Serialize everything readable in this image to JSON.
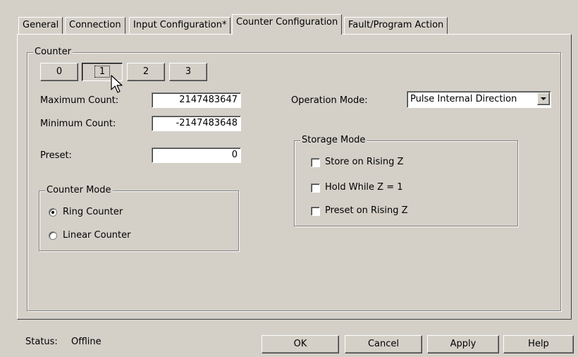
{
  "tabs": [
    {
      "label": "General",
      "active": false
    },
    {
      "label": "Connection",
      "active": false
    },
    {
      "label": "Input Configuration*",
      "active": false
    },
    {
      "label": "Counter Configuration",
      "active": true
    },
    {
      "label": "Fault/Program Action",
      "active": false
    }
  ],
  "counter": {
    "group_label": "Counter",
    "buttons": [
      "0",
      "1",
      "2",
      "3"
    ],
    "selected": "1",
    "max_count_label": "Maximum Count:",
    "max_count_value": "2147483647",
    "min_count_label": "Minimum Count:",
    "min_count_value": "-2147483648",
    "preset_label": "Preset:",
    "preset_value": "0"
  },
  "counter_mode": {
    "group_label": "Counter Mode",
    "options": [
      "Ring Counter",
      "Linear Counter"
    ],
    "selected": "Ring Counter"
  },
  "operation_mode": {
    "label": "Operation Mode:",
    "value": "Pulse Internal Direction"
  },
  "storage_mode": {
    "group_label": "Storage Mode",
    "options": [
      {
        "label": "Store on Rising Z",
        "checked": false
      },
      {
        "label": "Hold While Z = 1",
        "checked": false
      },
      {
        "label": "Preset on Rising Z",
        "checked": false
      }
    ]
  },
  "status": {
    "label": "Status:",
    "value": "Offline"
  },
  "footer_buttons": {
    "ok": "OK",
    "cancel": "Cancel",
    "apply": "Apply",
    "help": "Help"
  },
  "icons": {
    "dropdown": "chevron-down-icon",
    "cursor": "mouse-pointer-icon"
  }
}
